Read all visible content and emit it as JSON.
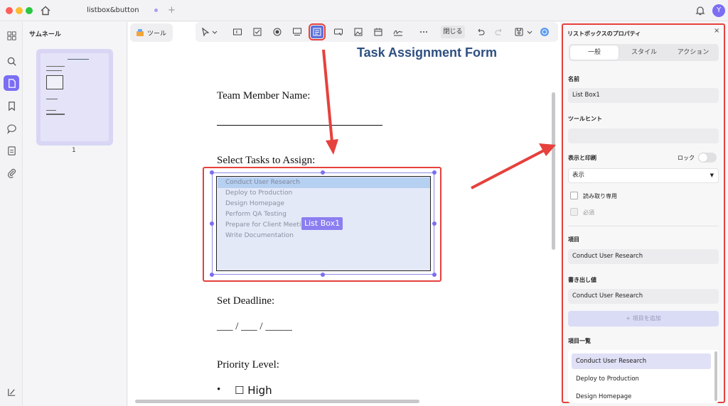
{
  "titlebar": {
    "tab_title": "listbox&button",
    "avatar_letter": "Y"
  },
  "thumbnails": {
    "title": "サムネール",
    "page_number": "1"
  },
  "toolbar": {
    "tool_label": "ツール",
    "close_label": "閉じる"
  },
  "document": {
    "title": "Task Assignment Form",
    "team_member_label": "Team Member Name:",
    "select_tasks_label": "Select Tasks to Assign:",
    "listbox_items": [
      "Conduct User Research",
      "Deploy to Production",
      "Design Homepage",
      "Perform QA Testing",
      "Prepare for Client Meetin",
      "Write Documentation"
    ],
    "listbox_tag": "List Box1",
    "deadline_label": "Set Deadline:",
    "deadline_blanks": "___ / ___ / _____",
    "priority_label": "Priority Level:",
    "priority_bullet": "•",
    "priority_option": "☐ High"
  },
  "properties": {
    "title": "リストボックスのプロパティ",
    "close": "×",
    "tabs": [
      "一般",
      "スタイル",
      "アクション"
    ],
    "name_label": "名前",
    "name_value": "List Box1",
    "tooltip_label": "ツールヒント",
    "tooltip_value": "",
    "display_print_label": "表示と印刷",
    "lock_label": "ロック",
    "display_value": "表示",
    "readonly_label": "読み取り専用",
    "required_label": "必須",
    "item_label": "項目",
    "item_value": "Conduct User Research",
    "export_label": "書き出し値",
    "export_value": "Conduct User Research",
    "add_item_label": "+ 項目を追加",
    "item_list_label": "項目一覧",
    "item_list": [
      "Conduct User Research",
      "Deploy to Production",
      "Design Homepage"
    ]
  },
  "colors": {
    "accent": "#7b6ef3",
    "annotation_red": "#e6413c",
    "title_blue": "#2e4f80"
  }
}
